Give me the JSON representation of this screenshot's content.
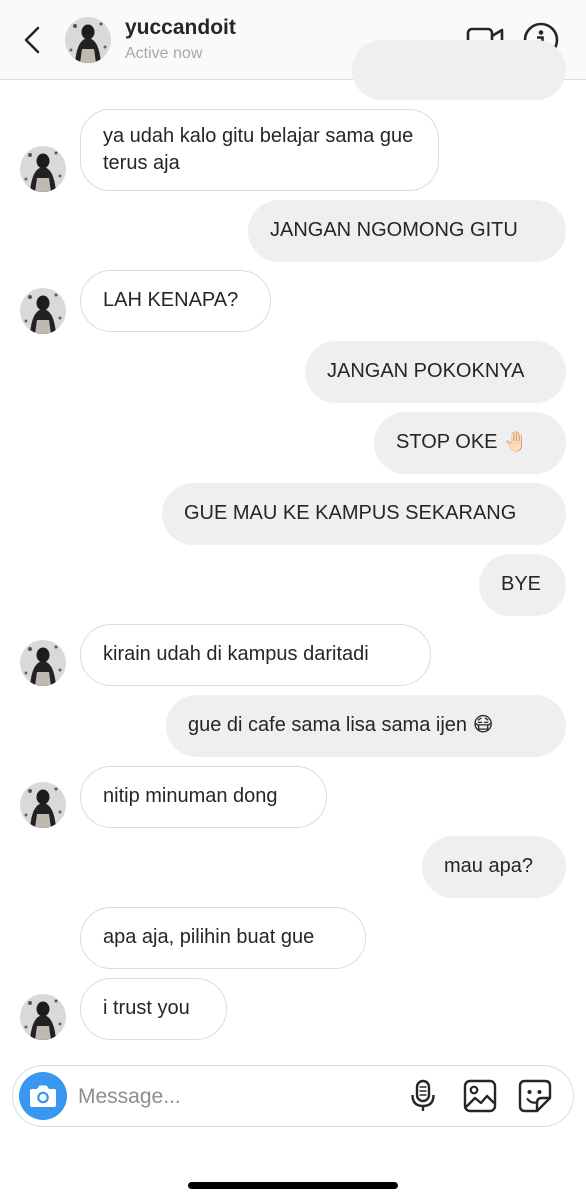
{
  "header": {
    "username": "yuccandoit",
    "status": "Active now"
  },
  "messages": [
    {
      "direction": "incoming",
      "text": "ya udah kalo gitu belajar sama gue terus aja"
    },
    {
      "direction": "outgoing",
      "text": "JANGAN NGOMONG GITU"
    },
    {
      "direction": "incoming",
      "text": "LAH KENAPA?"
    },
    {
      "direction": "outgoing",
      "text": "JANGAN POKOKNYA"
    },
    {
      "direction": "outgoing",
      "text": "STOP OKE 🤚🏻"
    },
    {
      "direction": "outgoing",
      "text": "GUE MAU KE KAMPUS SEKARANG"
    },
    {
      "direction": "outgoing",
      "text": "BYE"
    },
    {
      "direction": "incoming",
      "text": "kirain udah di kampus daritadi"
    },
    {
      "direction": "outgoing",
      "text": "gue di cafe sama lisa sama ijen 😷"
    },
    {
      "direction": "incoming",
      "text": "nitip minuman dong"
    },
    {
      "direction": "outgoing",
      "text": "mau apa?"
    },
    {
      "direction": "incoming",
      "text": "apa aja, pilihin buat gue"
    },
    {
      "direction": "incoming",
      "text": "i trust you"
    }
  ],
  "composer": {
    "placeholder": "Message..."
  },
  "icons": {
    "back": "chevron-left-icon",
    "video": "video-camera-icon",
    "info": "info-icon",
    "camera": "camera-icon",
    "mic": "microphone-icon",
    "gallery": "image-icon",
    "sticker": "sticker-icon"
  },
  "colors": {
    "accent": "#3897f0",
    "outgoing_bubble": "#efefef",
    "incoming_border": "#dbdbdb"
  }
}
